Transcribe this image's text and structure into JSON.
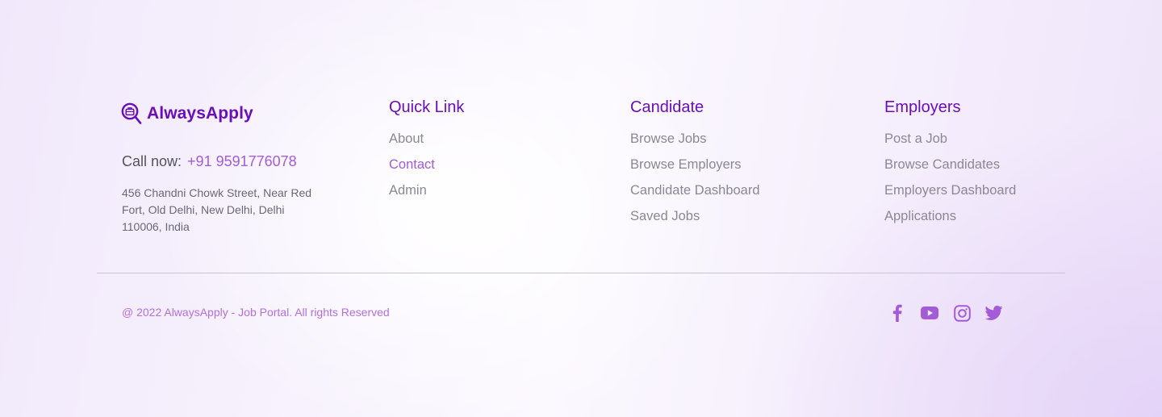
{
  "brand": {
    "name": "AlwaysApply",
    "logo_icon": "search-briefcase-icon"
  },
  "contact": {
    "call_label": "Call now:",
    "phone": "+91 9591776078",
    "address": "456 Chandni Chowk Street, Near Red Fort, Old Delhi, New Delhi, Delhi 110006, India"
  },
  "quick_links": {
    "title": "Quick Link",
    "items": [
      "About",
      "Contact",
      "Admin"
    ]
  },
  "candidate": {
    "title": "Candidate",
    "items": [
      "Browse Jobs",
      "Browse Employers",
      "Candidate Dashboard",
      "Saved Jobs"
    ]
  },
  "employers": {
    "title": "Employers",
    "items": [
      "Post a Job",
      "Browse Candidates",
      "Employers Dashboard",
      "Applications"
    ]
  },
  "bottom": {
    "copyright": "@ 2022 AlwaysApply - Job Portal. All rights Reserved",
    "social": [
      "facebook-icon",
      "youtube-icon",
      "instagram-icon",
      "twitter-icon"
    ]
  },
  "colors": {
    "brand": "#6a0fb8",
    "accent": "#a35bd8",
    "link": "#8b8894"
  }
}
